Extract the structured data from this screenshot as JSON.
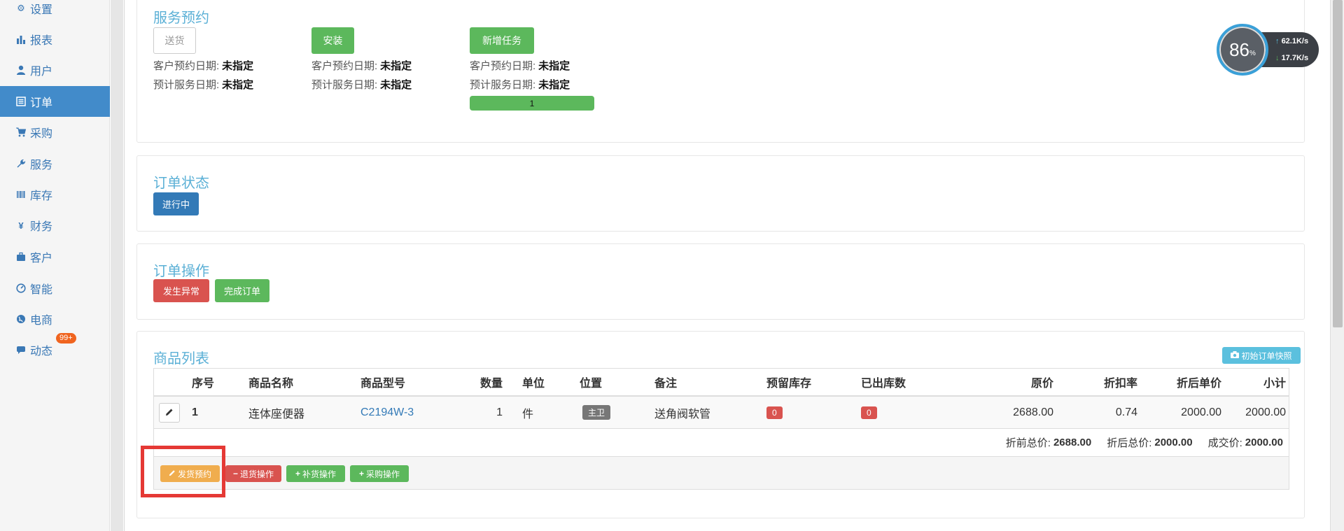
{
  "sidebar": {
    "items": [
      {
        "label": "设置",
        "icon": "gear-icon",
        "glyph": "⚙"
      },
      {
        "label": "报表",
        "icon": "bar-chart-icon",
        "glyph": "▮"
      },
      {
        "label": "用户",
        "icon": "user-icon",
        "glyph": "👤"
      },
      {
        "label": "订单",
        "icon": "list-icon",
        "glyph": "☰"
      },
      {
        "label": "采购",
        "icon": "cart-icon",
        "glyph": "🛒"
      },
      {
        "label": "服务",
        "icon": "wrench-icon",
        "glyph": "🔧"
      },
      {
        "label": "库存",
        "icon": "barcode-icon",
        "glyph": "|||"
      },
      {
        "label": "财务",
        "icon": "yen-icon",
        "glyph": "¥"
      },
      {
        "label": "客户",
        "icon": "briefcase-icon",
        "glyph": "💼"
      },
      {
        "label": "智能",
        "icon": "dashboard-icon",
        "glyph": "◔"
      },
      {
        "label": "电商",
        "icon": "globe-icon",
        "glyph": "◕"
      },
      {
        "label": "动态",
        "icon": "comment-icon",
        "glyph": "▬",
        "badge": "99+"
      }
    ],
    "active_index": 3
  },
  "service": {
    "title": "服务预约",
    "columns": [
      {
        "button": "送货",
        "style": "default",
        "customer_date_label": "客户预约日期:",
        "customer_date_value": "未指定",
        "service_date_label": "预计服务日期:",
        "service_date_value": "未指定"
      },
      {
        "button": "安装",
        "style": "green",
        "customer_date_label": "客户预约日期:",
        "customer_date_value": "未指定",
        "service_date_label": "预计服务日期:",
        "service_date_value": "未指定"
      },
      {
        "button": "新增任务",
        "style": "green",
        "customer_date_label": "客户预约日期:",
        "customer_date_value": "未指定",
        "service_date_label": "预计服务日期:",
        "service_date_value": "未指定",
        "progress": "1"
      }
    ]
  },
  "status": {
    "title": "订单状态",
    "button": "进行中"
  },
  "operations": {
    "title": "订单操作",
    "abnormal": "发生异常",
    "complete": "完成订单"
  },
  "products": {
    "title": "商品列表",
    "snapshot": "初始订单快照",
    "headers": [
      "序号",
      "商品名称",
      "商品型号",
      "数量",
      "单位",
      "位置",
      "备注",
      "预留库存",
      "已出库数",
      "原价",
      "折扣率",
      "折后单价",
      "小计"
    ],
    "rows": [
      {
        "no": "1",
        "name": "连体座便器",
        "model": "C2194W-3",
        "qty": "1",
        "unit": "件",
        "location": "主卫",
        "remark": "送角阀软管",
        "reserved": "0",
        "shipped": "0",
        "price": "2688.00",
        "discount": "0.74",
        "unit_after": "2000.00",
        "subtotal": "2000.00"
      }
    ],
    "summary": {
      "before_label": "折前总价:",
      "before_value": "2688.00",
      "after_label": "折后总价:",
      "after_value": "2000.00",
      "deal_label": "成交价:",
      "deal_value": "2000.00"
    },
    "actions": {
      "ship": "发货预约",
      "return": "退货操作",
      "restock": "补货操作",
      "purchase": "采购操作"
    }
  },
  "net_widget": {
    "percent": "86",
    "percent_unit": "%",
    "up": "62.1K/s",
    "down": "17.7K/s"
  },
  "colors": {
    "accent": "#428bca",
    "title": "#5bb0d6",
    "green": "#5cb85c",
    "red": "#d9534f",
    "orange": "#f0ad4e",
    "highlight": "#e53935"
  }
}
